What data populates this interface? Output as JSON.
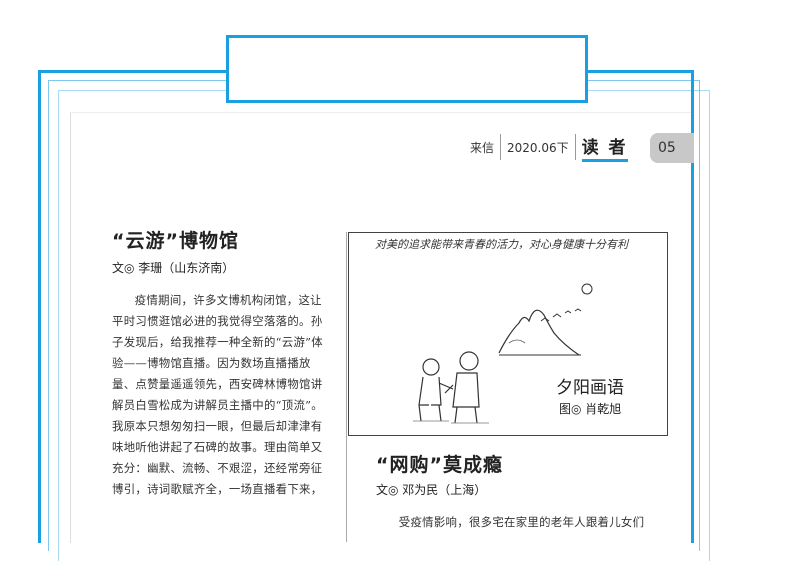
{
  "header": {
    "section": "来信",
    "issue": "2020.06下",
    "magazine": "读 者",
    "page_number": "05"
  },
  "article_left": {
    "title": "“云游”博物馆",
    "byline": "文◎ 李珊（山东济南）",
    "body": "疫情期间，许多文博机构闭馆，这让平时习惯逛馆必进的我觉得空落落的。孙子发现后，给我推荐一种全新的“云游”体验——博物馆直播。因为数场直播播放量、点赞量遥遥领先，西安碑林博物馆讲解员白雪松成为讲解员主播中的“顶流”。我原本只想匆匆扫一眼，但最后却津津有味地听他讲起了石碑的故事。理由简单又充分：幽默、流畅、不艰涩，还经常旁征博引，诗词歌赋齐全，一场直播看下来，"
  },
  "cartoon": {
    "caption": "对美的追求能带来青春的活力，对心身健康十分有利",
    "title": "夕阳画语",
    "credit": "图◎ 肖乾旭"
  },
  "article_right": {
    "title": "“网购”莫成瘾",
    "byline": "文◎ 邓为民（上海）",
    "body": "受疫情影响，很多宅在家里的老年人跟着儿女们"
  },
  "colors": {
    "frame_blue": "#1aa0e0",
    "page_tab_gray": "#c8c8c8"
  }
}
